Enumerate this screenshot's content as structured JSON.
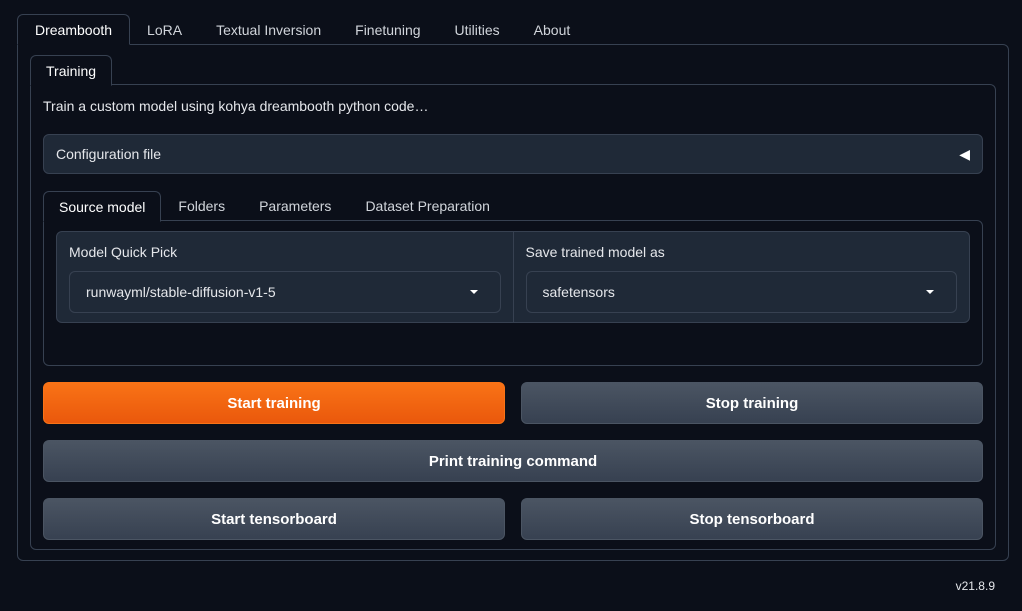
{
  "top_tabs": [
    {
      "label": "Dreambooth",
      "active": true
    },
    {
      "label": "LoRA"
    },
    {
      "label": "Textual Inversion"
    },
    {
      "label": "Finetuning"
    },
    {
      "label": "Utilities"
    },
    {
      "label": "About"
    }
  ],
  "sub_tab": {
    "label": "Training"
  },
  "description": "Train a custom model using kohya dreambooth python code…",
  "accordion": {
    "label": "Configuration file",
    "arrow": "◀"
  },
  "source_tabs": [
    {
      "label": "Source model",
      "active": true
    },
    {
      "label": "Folders"
    },
    {
      "label": "Parameters"
    },
    {
      "label": "Dataset Preparation"
    }
  ],
  "fields": {
    "model_quick_pick": {
      "label": "Model Quick Pick",
      "value": "runwayml/stable-diffusion-v1-5"
    },
    "save_as": {
      "label": "Save trained model as",
      "value": "safetensors"
    }
  },
  "buttons": {
    "start_training": "Start training",
    "stop_training": "Stop training",
    "print_command": "Print training command",
    "start_tensorboard": "Start tensorboard",
    "stop_tensorboard": "Stop tensorboard"
  },
  "version": "v21.8.9",
  "colors": {
    "accent": "#f97316",
    "background": "#0b0f19",
    "panel": "#1f2937"
  }
}
